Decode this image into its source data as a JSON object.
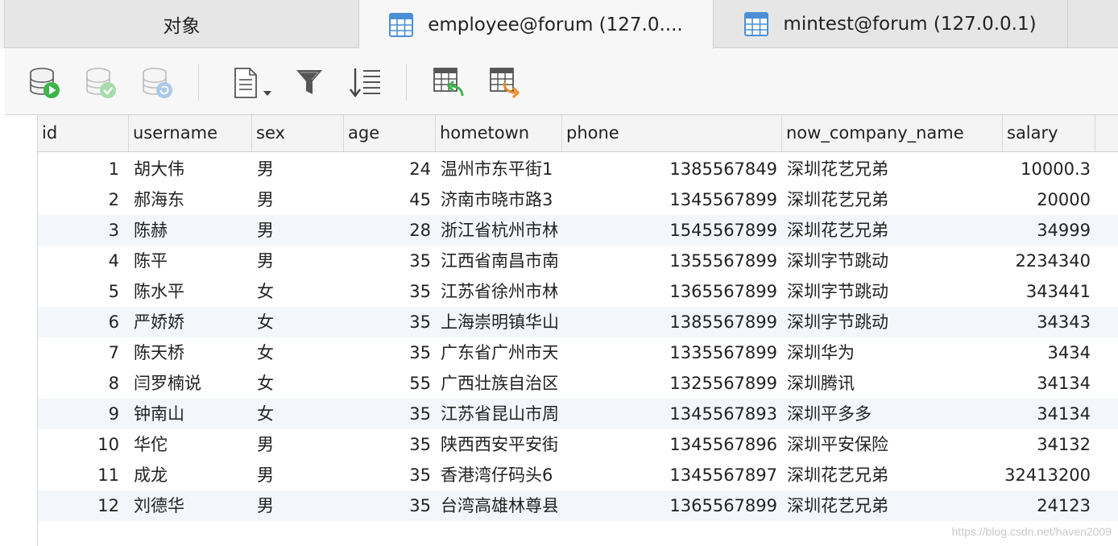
{
  "tabs": [
    {
      "label": "对象",
      "icon": "none",
      "active": false
    },
    {
      "label": "employee@forum (127.0....",
      "icon": "table-icon",
      "active": true
    },
    {
      "label": "mintest@forum (127.0.0.1)",
      "icon": "table-icon",
      "active": false
    }
  ],
  "toolbar": {
    "buttons": [
      "db-run-icon",
      "db-check-icon",
      "db-refresh-icon",
      "document-dropdown-icon",
      "filter-icon",
      "sort-icon",
      "table-import-icon",
      "table-export-icon"
    ]
  },
  "colors": {
    "accent_blue": "#4a8fd4",
    "green": "#3bb54a",
    "orange": "#f08a24",
    "row_alt": "#f3f7fc"
  },
  "table": {
    "columns": [
      "id",
      "username",
      "sex",
      "age",
      "hometown",
      "phone",
      "now_company_name",
      "salary"
    ],
    "rows": [
      [
        "1",
        "胡大伟",
        "男",
        "24",
        "温州市东平街1",
        "1385567849",
        "深圳花艺兄弟",
        "10000.3"
      ],
      [
        "2",
        "郝海东",
        "男",
        "45",
        "济南市晓市路3",
        "1345567899",
        "深圳花艺兄弟",
        "20000"
      ],
      [
        "3",
        "陈赫",
        "男",
        "28",
        "浙江省杭州市林",
        "1545567899",
        "深圳花艺兄弟",
        "34999"
      ],
      [
        "4",
        "陈平",
        "男",
        "35",
        "江西省南昌市南",
        "1355567899",
        "深圳字节跳动",
        "2234340"
      ],
      [
        "5",
        "陈水平",
        "女",
        "35",
        "江苏省徐州市林",
        "1365567899",
        "深圳字节跳动",
        "343441"
      ],
      [
        "6",
        "严娇娇",
        "女",
        "35",
        "上海崇明镇华山",
        "1385567899",
        "深圳字节跳动",
        "34343"
      ],
      [
        "7",
        "陈天桥",
        "女",
        "35",
        "广东省广州市天",
        "1335567899",
        "深圳华为",
        "3434"
      ],
      [
        "8",
        "闫罗楠说",
        "女",
        "55",
        "广西壮族自治区",
        "1325567899",
        "深圳腾讯",
        "34134"
      ],
      [
        "9",
        "钟南山",
        "女",
        "35",
        "江苏省昆山市周",
        "1345567893",
        "深圳平多多",
        "34134"
      ],
      [
        "10",
        "华佗",
        "男",
        "35",
        "陕西西安平安街",
        "1345567896",
        "深圳平安保险",
        "34132"
      ],
      [
        "11",
        "成龙",
        "男",
        "35",
        "香港湾仔码头6",
        "1345567897",
        "深圳花艺兄弟",
        "32413200"
      ],
      [
        "12",
        "刘德华",
        "男",
        "35",
        "台湾高雄林尊县",
        "1365567899",
        "深圳花艺兄弟",
        "24123"
      ]
    ]
  },
  "watermark": "https://blog.csdn.net/haven2009"
}
